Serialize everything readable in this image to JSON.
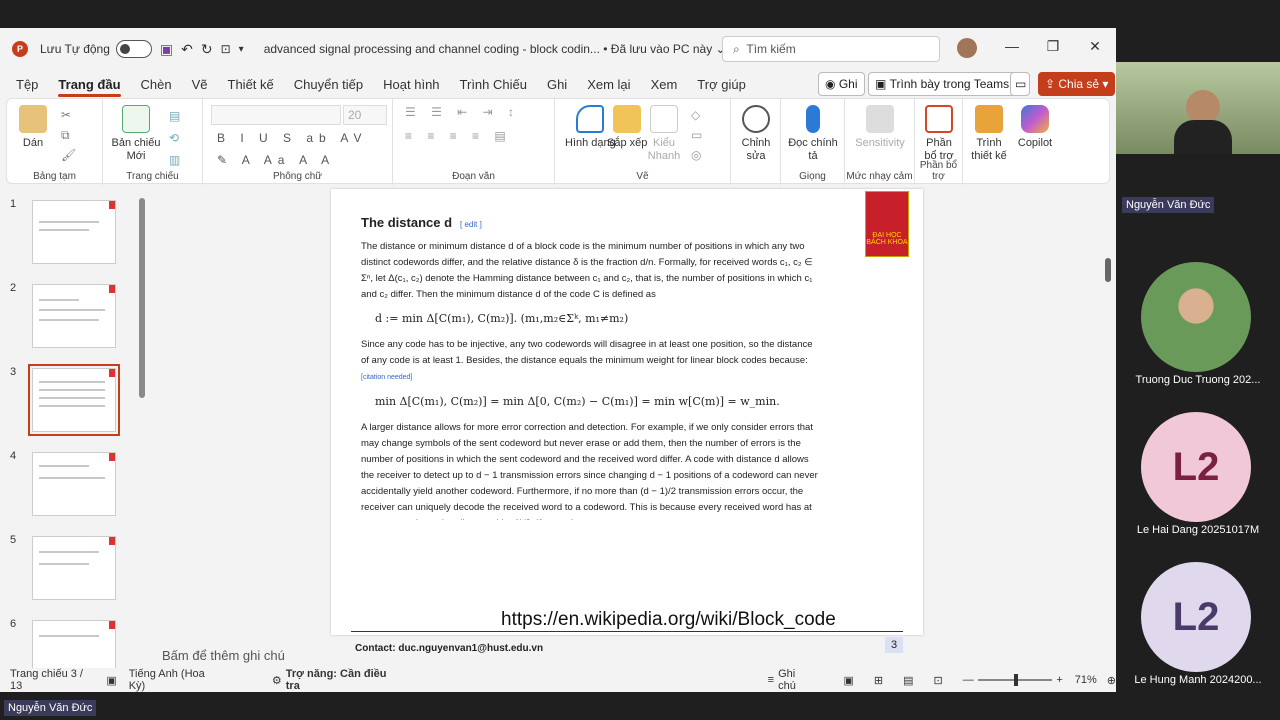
{
  "titlebar": {
    "autosave_label": "Lưu Tự động",
    "doc_title": "advanced signal processing and channel coding - block codin...",
    "save_status": "• Đã lưu vào PC này",
    "search_placeholder": "Tìm kiếm"
  },
  "menu": [
    "Tệp",
    "Trang đầu",
    "Chèn",
    "Vẽ",
    "Thiết kế",
    "Chuyển tiếp",
    "Hoạt hình",
    "Trình Chiếu",
    "Ghi",
    "Xem lại",
    "Xem",
    "Trợ giúp"
  ],
  "menu_right": {
    "record": "Ghi",
    "present_teams": "Trình bày trong Teams",
    "share": "Chia sẻ"
  },
  "ribbon": {
    "paste": "Dán",
    "clipboard": "Bảng tạm",
    "new_slide": "Bản chiếu Mới",
    "slides": "Trang chiếu",
    "font_size": "20",
    "font": "Phông chữ",
    "paragraph": "Đoạn văn",
    "shapes": "Hình dạng",
    "arrange": "Sắp xếp",
    "quick_styles": "Kiểu Nhanh",
    "drawing": "Vẽ",
    "editing": "Chỉnh sửa",
    "dictate": "Đọc chính tả",
    "voice": "Giọng",
    "sensitivity": "Sensitivity",
    "sensitivity_group": "Mức nhạy cảm",
    "addins": "Phần bổ trợ",
    "addins_group": "Phần bổ trợ",
    "designer": "Trình thiết kế",
    "copilot": "Copilot"
  },
  "thumbs": [
    "1",
    "2",
    "3",
    "4",
    "5",
    "6"
  ],
  "slide": {
    "title": "The distance d",
    "edit": "[ edit ]",
    "p1": "The distance or minimum distance d of a block code is the minimum number of positions in which any two distinct codewords differ, and the relative distance δ is the fraction d/n. Formally, for received words c₁, c₂ ∈ Σⁿ, let Δ(c₁, c₂) denote the Hamming distance between c₁ and c₂, that is, the number of positions in which c₁ and c₂ differ. Then the minimum distance d of the code C is defined as",
    "f1": "d := min Δ[C(m₁), C(m₂)].   (m₁,m₂∈Σᵏ, m₁≠m₂)",
    "p2": "Since any code has to be injective, any two codewords will disagree in at least one position, so the distance of any code is at least 1. Besides, the distance equals the minimum weight for linear block codes because:",
    "citation": "[citation needed]",
    "f2": "min Δ[C(m₁), C(m₂)] = min Δ[0, C(m₂) − C(m₁)] = min w[C(m)] = w_min.",
    "p3": "A larger distance allows for more error correction and detection. For example, if we only consider errors that may change symbols of the sent codeword but never erase or add them, then the number of errors is the number of positions in which the sent codeword and the received word differ. A code with distance d allows the receiver to detect up to d − 1 transmission errors since changing d − 1 positions of a codeword can never accidentally yield another codeword. Furthermore, if no more than (d − 1)/2 transmission errors occur, the receiver can uniquely decode the received word to a codeword. This is because every received word has at most one codeword at distance (d − 1)/2. If more than",
    "logo_text": "ĐẠI HỌC BÁCH KHOA",
    "url": "https://en.wikipedia.org/wiki/Block_code",
    "contact": "Contact: duc.nguyenvan1@hust.edu.vn",
    "page": "3"
  },
  "notes": "Bấm để thêm ghi chú",
  "status": {
    "slide": "Trang chiếu 3 / 13",
    "lang": "Tiếng Anh (Hoa Kỳ)",
    "access": "Trợ năng: Cần điều tra",
    "notes": "Ghi chú",
    "zoom": "71%"
  },
  "participants": [
    {
      "name": "Nguyễn Văn Đức"
    },
    {
      "name": "Truong Duc Truong 202..."
    },
    {
      "name": "Le Hai Dang 20251017M",
      "initials": "L2"
    },
    {
      "name": "Le Hung Manh 2024200...",
      "initials": "L2"
    }
  ],
  "bottom_tag": "Nguyễn Văn Đức"
}
